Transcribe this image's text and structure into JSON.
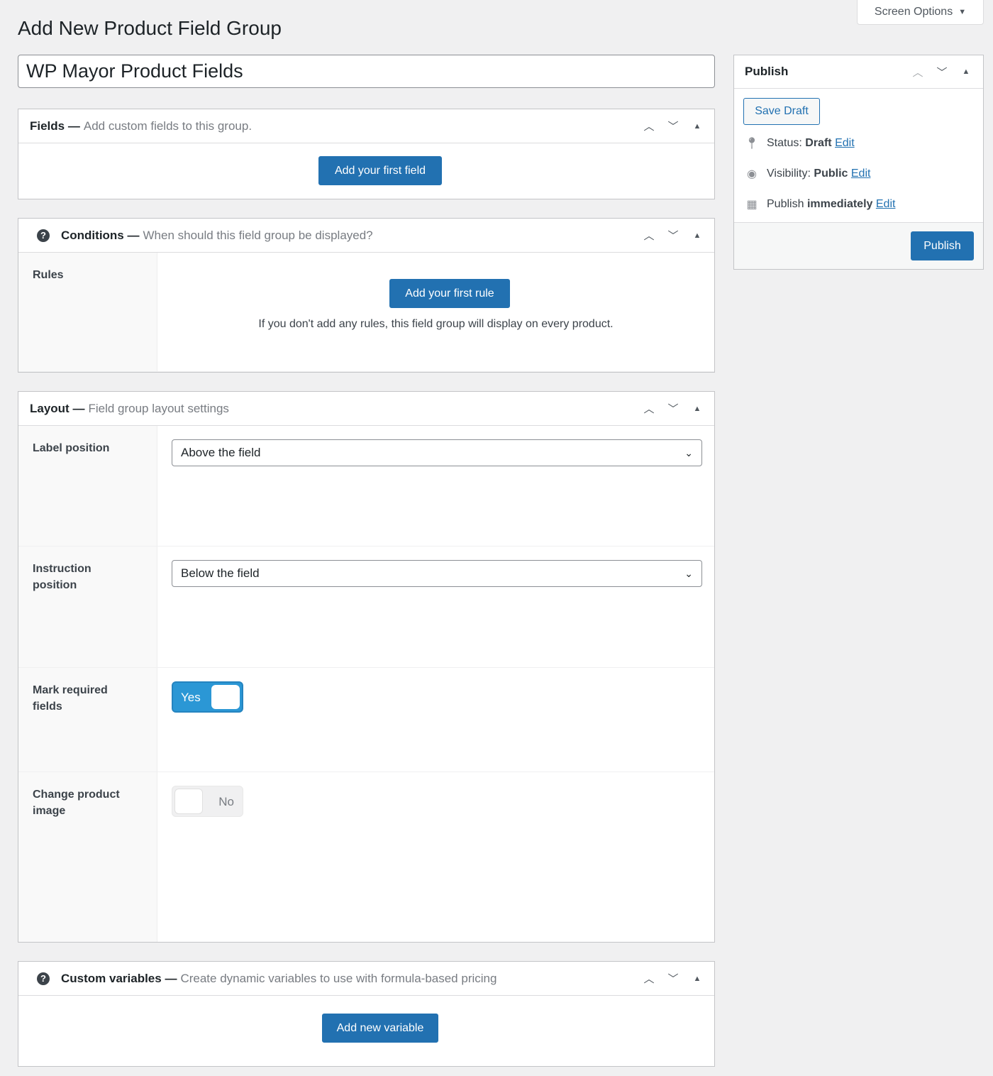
{
  "page": {
    "title": "Add New Product Field Group",
    "screen_options": "Screen Options"
  },
  "title_input": {
    "value": "WP Mayor Product Fields"
  },
  "fields": {
    "title": "Fields —",
    "subtitle": "Add custom fields to this group.",
    "button": "Add your first field"
  },
  "conditions": {
    "title": "Conditions —",
    "subtitle": "When should this field group be displayed?",
    "rules_label": "Rules",
    "button": "Add your first rule",
    "note": "If you don't add any rules, this field group will display on every product."
  },
  "layout": {
    "title": "Layout —",
    "subtitle": "Field group layout settings",
    "label_position": {
      "label": "Label position",
      "value": "Above the field"
    },
    "instruction_position": {
      "label": "Instruction position",
      "value": "Below the field"
    },
    "mark_required": {
      "label": "Mark required fields",
      "value": "Yes",
      "on": true
    },
    "change_image": {
      "label": "Change product image",
      "value": "No",
      "on": false
    }
  },
  "custom_variables": {
    "title": "Custom variables —",
    "subtitle": "Create dynamic variables to use with formula-based pricing",
    "button": "Add new variable"
  },
  "publish": {
    "title": "Publish",
    "save_draft": "Save Draft",
    "status_label": "Status:",
    "status_value": "Draft",
    "visibility_label": "Visibility:",
    "visibility_value": "Public",
    "schedule_label": "Publish",
    "schedule_value": "immediately",
    "edit": "Edit",
    "publish_button": "Publish"
  },
  "colors": {
    "primary": "#2271b1",
    "toggle_on": "#2b97d5"
  }
}
